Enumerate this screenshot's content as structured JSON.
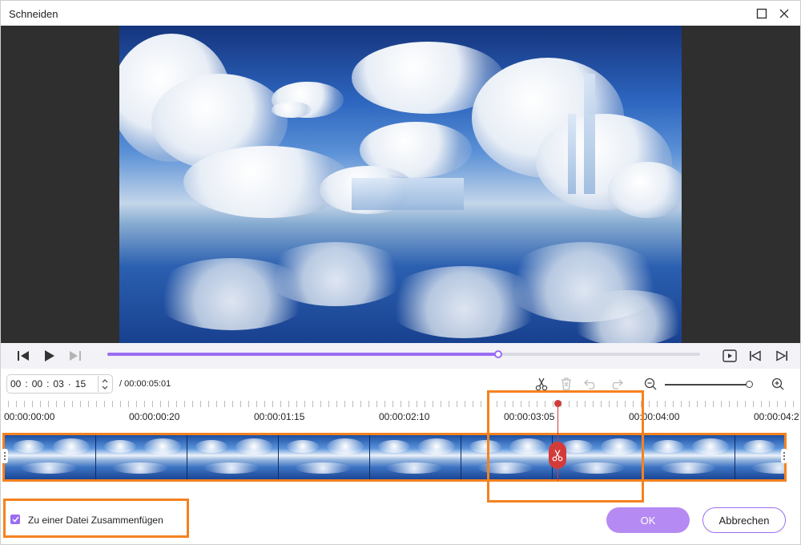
{
  "window": {
    "title": "Schneiden"
  },
  "player": {
    "progress_fraction": 0.66
  },
  "time_input": {
    "hours": "00",
    "minutes": "00",
    "seconds": "03",
    "frames": "15",
    "separator": ":",
    "frame_separator": "·",
    "total_duration": "/ 00:00:05:01"
  },
  "zoom": {
    "level_fraction": 0.95
  },
  "ruler": {
    "labels": [
      "00:00:00:00",
      "00:00:00:20",
      "00:00:01:15",
      "00:00:02:10",
      "00:00:03:05",
      "00:00:04:00",
      "00:00:04:2"
    ]
  },
  "merge": {
    "checked": true,
    "label": "Zu einer Datei Zusammenfügen"
  },
  "buttons": {
    "ok": "OK",
    "cancel": "Abbrechen"
  },
  "colors": {
    "accent": "#9b6df2",
    "ok_button": "#b68af3",
    "playhead": "#d33b3b",
    "highlight": "#f5821f",
    "player_bg": "#2f2f2f"
  },
  "icons": {
    "window": [
      "maximize-icon",
      "close-icon"
    ],
    "player": [
      "previous-frame-icon",
      "play-icon",
      "next-frame-icon",
      "preview-icon",
      "jump-start-icon",
      "jump-end-icon"
    ],
    "toolbar": [
      "scissors-icon",
      "delete-icon",
      "undo-icon",
      "redo-icon",
      "zoom-out-icon",
      "zoom-in-icon"
    ]
  }
}
